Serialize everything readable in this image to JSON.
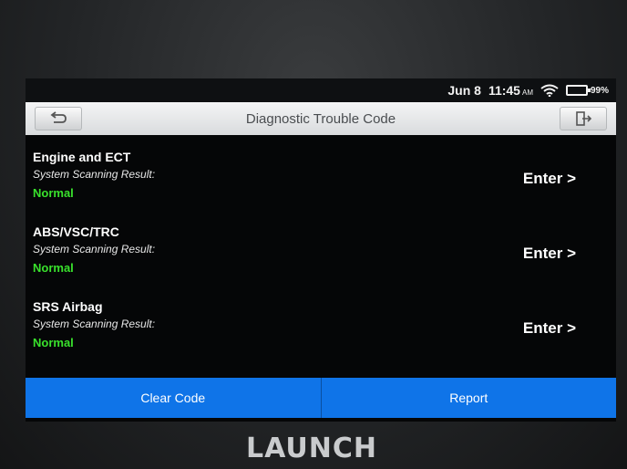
{
  "statusbar": {
    "date": "Jun 8",
    "time": "11:45",
    "ampm": "AM",
    "battery": "99%"
  },
  "header": {
    "title": "Diagnostic Trouble Code",
    "back_icon": "back-arrow-icon",
    "exit_icon": "exit-icon"
  },
  "systems": [
    {
      "name": "Engine and ECT",
      "label": "System Scanning Result:",
      "status": "Normal",
      "enter": "Enter >"
    },
    {
      "name": "ABS/VSC/TRC",
      "label": "System Scanning Result:",
      "status": "Normal",
      "enter": "Enter >"
    },
    {
      "name": "SRS Airbag",
      "label": "System Scanning Result:",
      "status": "Normal",
      "enter": "Enter >"
    }
  ],
  "actions": {
    "clear_code": "Clear Code",
    "report": "Report"
  },
  "brand": "LAUNCH",
  "colors": {
    "accent": "#0f74e8",
    "status_ok": "#39e12c",
    "titlebar": "#e6e7e8"
  }
}
